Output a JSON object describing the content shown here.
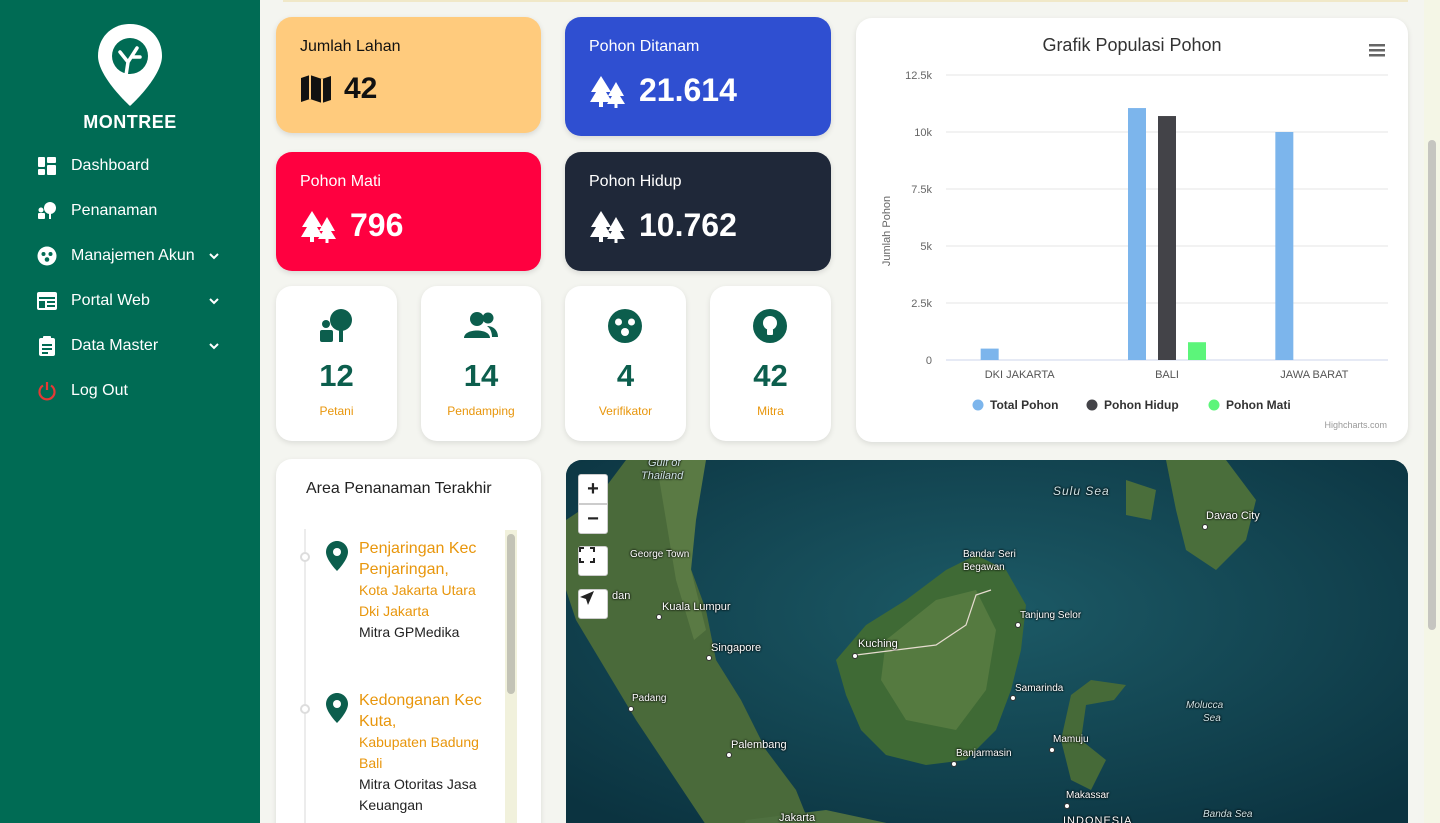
{
  "brand": {
    "name": "MONTREE"
  },
  "nav": [
    {
      "label": "Dashboard",
      "icon": "dashboard-icon",
      "has_submenu": false
    },
    {
      "label": "Penanaman",
      "icon": "planting-icon",
      "has_submenu": false
    },
    {
      "label": "Manajemen Akun",
      "icon": "account-group-icon",
      "has_submenu": true
    },
    {
      "label": "Portal Web",
      "icon": "web-portal-icon",
      "has_submenu": true
    },
    {
      "label": "Data Master",
      "icon": "clipboard-icon",
      "has_submenu": true
    },
    {
      "label": "Log Out",
      "icon": "power-icon",
      "has_submenu": false
    }
  ],
  "stats": {
    "lahan": {
      "title": "Jumlah Lahan",
      "value": "42",
      "color": "#FFCB7D"
    },
    "ditanam": {
      "title": "Pohon Ditanam",
      "value": "21.614",
      "color": "#2F4FD1"
    },
    "mati": {
      "title": "Pohon Mati",
      "value": "796",
      "color": "#FF0040"
    },
    "hidup": {
      "title": "Pohon Hidup",
      "value": "10.762",
      "color": "#1F2839"
    }
  },
  "minis": [
    {
      "value": "12",
      "label": "Petani",
      "icon": "farmer-icon"
    },
    {
      "value": "14",
      "label": "Pendamping",
      "icon": "users-icon"
    },
    {
      "value": "4",
      "label": "Verifikator",
      "icon": "verifier-icon"
    },
    {
      "value": "42",
      "label": "Mitra",
      "icon": "lightbulb-icon"
    }
  ],
  "chart_data": {
    "type": "bar",
    "title": "Grafik Populasi Pohon",
    "ylabel": "Jumlah Pohon",
    "xlabel": "",
    "categories": [
      "DKI JAKARTA",
      "BALI",
      "JAWA BARAT"
    ],
    "ylim": [
      0,
      12500
    ],
    "yticks": [
      0,
      2500,
      5000,
      7500,
      10000,
      12500
    ],
    "ytick_labels": [
      "0",
      "2.5k",
      "5k",
      "7.5k",
      "10k",
      "12.5k"
    ],
    "series": [
      {
        "name": "Total Pohon",
        "color": "#7cb5ec",
        "values": [
          500,
          11050,
          10000
        ]
      },
      {
        "name": "Pohon Hidup",
        "color": "#434348",
        "values": [
          0,
          10700,
          0
        ]
      },
      {
        "name": "Pohon Mati",
        "color": "#5cf57a",
        "values": [
          0,
          780,
          0
        ]
      }
    ],
    "legend": "bottom-center",
    "credits": "Highcharts.com",
    "grid": true
  },
  "recent": {
    "title": "Area Penanaman Terakhir",
    "items": [
      {
        "title1": "Penjaringan Kec",
        "title2": "Penjaringan,",
        "city": "Kota Jakarta Utara",
        "province": "Dki Jakarta",
        "mitra1": "Mitra GPMedika",
        "mitra2": ""
      },
      {
        "title1": "Kedonganan Kec",
        "title2": "Kuta,",
        "city": "Kabupaten Badung",
        "province": "Bali",
        "mitra1": "Mitra Otoritas Jasa",
        "mitra2": "Keuangan"
      }
    ]
  },
  "map": {
    "zoom_in": "+",
    "zoom_out": "−",
    "labels": {
      "gulf1": "Gulf of",
      "gulf2": "Thailand",
      "sulu": "Sulu Sea",
      "davao": "Davao City",
      "george": "George Town",
      "bandar1": "Bandar Seri",
      "bandar2": "Begawan",
      "medan": "dan",
      "kl": "Kuala Lumpur",
      "tanjung": "Tanjung Selor",
      "singapore": "Singapore",
      "kuching": "Kuching",
      "samarinda": "Samarinda",
      "padang": "Padang",
      "molucca1": "Molucca",
      "molucca2": "Sea",
      "palembang": "Palembang",
      "mamuju": "Mamuju",
      "banjarmasin": "Banjarmasin",
      "makassar": "Makassar",
      "jakarta": "Jakarta",
      "indonesia": "INDONESIA",
      "banda": "Banda Sea"
    }
  }
}
